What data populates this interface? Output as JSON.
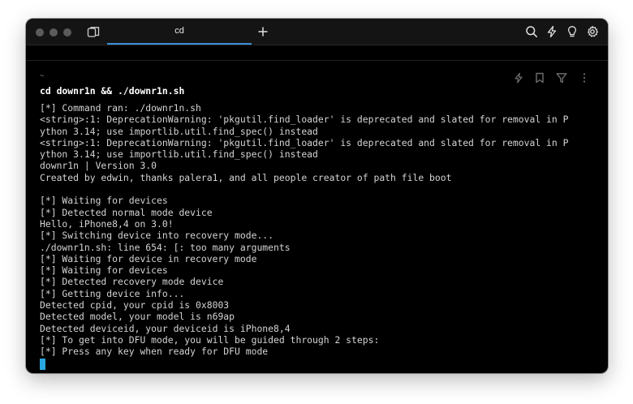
{
  "window": {
    "tab_label": "cd"
  },
  "terminal": {
    "cwd": "~",
    "command": "cd downr1n && ./downr1n.sh",
    "output": [
      "[*] Command ran: ./downr1n.sh",
      "<string>:1: DeprecationWarning: 'pkgutil.find_loader' is deprecated and slated for removal in P",
      "ython 3.14; use importlib.util.find_spec() instead",
      "<string>:1: DeprecationWarning: 'pkgutil.find_loader' is deprecated and slated for removal in P",
      "ython 3.14; use importlib.util.find_spec() instead",
      "downr1n | Version 3.0",
      "Created by edwin, thanks palera1, and all people creator of path file boot",
      "",
      "[*] Waiting for devices",
      "[*] Detected normal mode device",
      "Hello, iPhone8,4 on 3.0!",
      "[*] Switching device into recovery mode...",
      "./downr1n.sh: line 654: [: too many arguments",
      "[*] Waiting for device in recovery mode",
      "[*] Waiting for devices",
      "[*] Detected recovery mode device",
      "[*] Getting device info...",
      "Detected cpid, your cpid is 0x8003",
      "Detected model, your model is n69ap",
      "Detected deviceid, your deviceid is iPhone8,4",
      "[*] To get into DFU mode, you will be guided through 2 steps:",
      "[*] Press any key when ready for DFU mode"
    ]
  },
  "icons": {
    "sidebar_toggle": "sidebar-icon",
    "new_tab": "plus-icon",
    "search": "search-icon",
    "warp_ai": "bolt-icon",
    "hint": "lightbulb-icon",
    "settings": "gear-icon",
    "block_rerun": "bolt-icon",
    "block_bookmark": "bookmark-icon",
    "block_filter": "filter-icon",
    "block_more": "more-vertical-icon"
  },
  "colors": {
    "window_bg": "#000000",
    "titlebar_bg": "#141414",
    "text": "#d4d4d4",
    "command_text": "#ffffff",
    "accent": "#3d8fd6",
    "cursor": "#29a8e0"
  }
}
